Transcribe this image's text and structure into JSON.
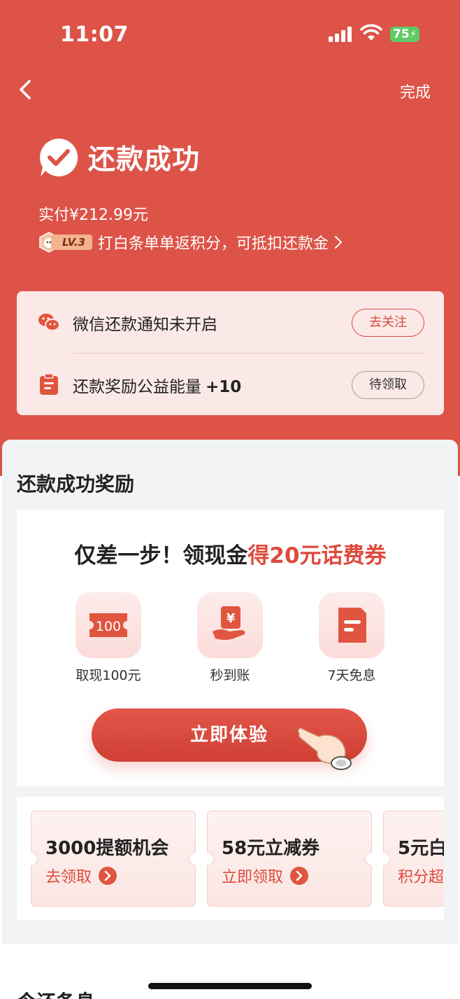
{
  "status_bar": {
    "time": "11:07",
    "battery": "75"
  },
  "nav": {
    "done_label": "完成"
  },
  "result": {
    "title": "还款成功",
    "paid": "实付¥212.99元",
    "level_badge": "LV.3",
    "level_message": "打白条单单返积分，可抵扣还款金"
  },
  "notices": [
    {
      "text": "微信还款通知未开启",
      "bonus": "",
      "button": "去关注"
    },
    {
      "text": "还款奖励公益能量",
      "bonus": "+10",
      "button": "待领取"
    }
  ],
  "rewards": {
    "section_title": "还款成功奖励",
    "headline_prefix": "仅差一步！领现金",
    "headline_highlight": "得20元话费券",
    "features": [
      {
        "label": "取现100元",
        "icon": "cash-100-icon",
        "icon_text": "100"
      },
      {
        "label": "秒到账",
        "icon": "yuan-hand-icon",
        "icon_text": "¥"
      },
      {
        "label": "7天免息",
        "icon": "document-icon"
      }
    ],
    "cta_label": "立即体验",
    "coupons": [
      {
        "title": "3000提额机会",
        "action": "去领取"
      },
      {
        "title": "58元立减券",
        "action": "立即领取"
      },
      {
        "title": "5元白",
        "action": "积分超"
      }
    ]
  },
  "next_section_title": "今还备息",
  "colors": {
    "brand_red": "#dd5347",
    "accent_red": "#dd4a3c",
    "panel_bg": "#f2f3f5"
  }
}
